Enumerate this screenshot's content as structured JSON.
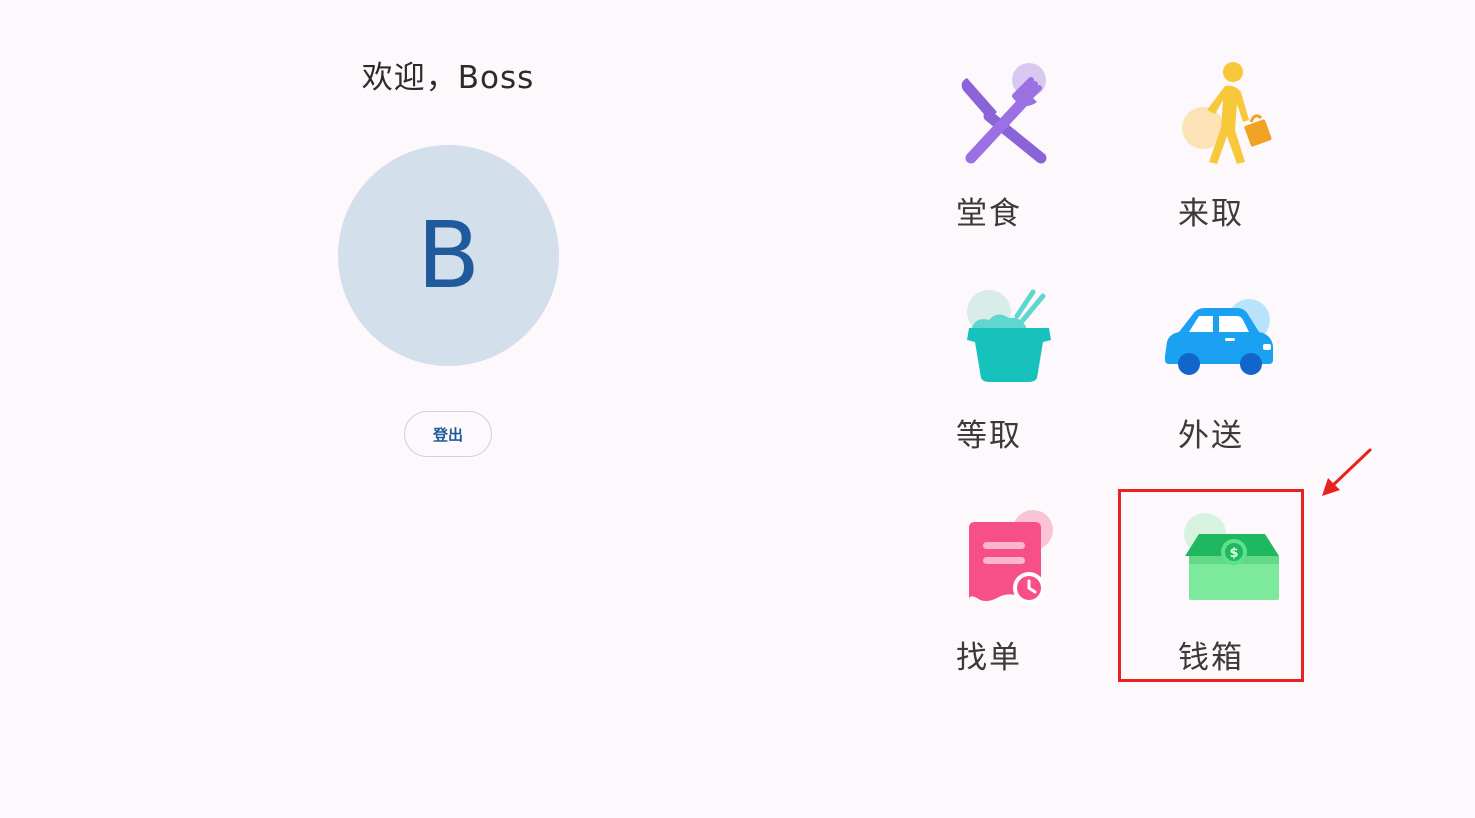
{
  "profile": {
    "welcome_text": "欢迎，Boss",
    "avatar_letter": "B",
    "logout_label": "登出"
  },
  "tiles": [
    {
      "label": "堂食",
      "icon": "fork-knife-icon"
    },
    {
      "label": "来取",
      "icon": "walking-person-bag-icon"
    },
    {
      "label": "等取",
      "icon": "rice-bowl-chopsticks-icon"
    },
    {
      "label": "外送",
      "icon": "car-icon"
    },
    {
      "label": "找单",
      "icon": "receipt-clock-icon"
    },
    {
      "label": "钱箱",
      "icon": "cash-drawer-icon"
    }
  ],
  "annotation": {
    "highlighted_tile": "钱箱",
    "color": "#e8221e"
  },
  "colors": {
    "background": "#fdf8fc",
    "avatar_bg": "#d3dfeb",
    "accent": "#1f5b9c"
  }
}
